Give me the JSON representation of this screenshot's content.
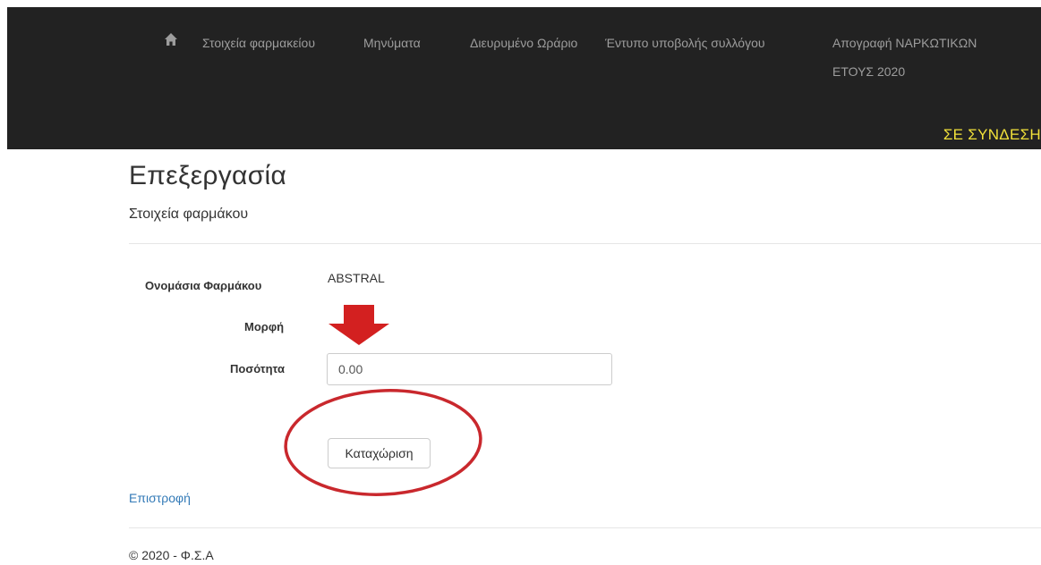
{
  "nav": {
    "items": [
      {
        "label": "Στοιχεία φαρμακείου"
      },
      {
        "label": "Μηνύματα"
      },
      {
        "label": "Διευρυμένο Ωράριο"
      },
      {
        "label": "Έντυπο υποβολής συλλόγου"
      },
      {
        "label": "Απογραφή ΝΑΡΚΩΤΙΚΩΝ ΕΤΟΥΣ 2020"
      }
    ],
    "status": "ΣΕ ΣΥΝΔΕΣΗ",
    "icon": "home-icon"
  },
  "page": {
    "title": "Επεξεργασία",
    "subtitle": "Στοιχεία φαρμάκου"
  },
  "form": {
    "name_label": "Ονομάσια Φαρμάκου",
    "name_value": "ABSTRAL",
    "form_label": "Μορφή",
    "quantity_label": "Ποσότητα",
    "quantity_value": "0.00",
    "submit_label": "Καταχώριση"
  },
  "back_link": "Επιστροφή",
  "footer": "© 2020 - Φ.Σ.Α",
  "colors": {
    "navbar_bg": "#222222",
    "nav_text": "#9d9d9d",
    "status_text": "#f1e13a",
    "link": "#337ab7",
    "annotation": "#d32020"
  }
}
